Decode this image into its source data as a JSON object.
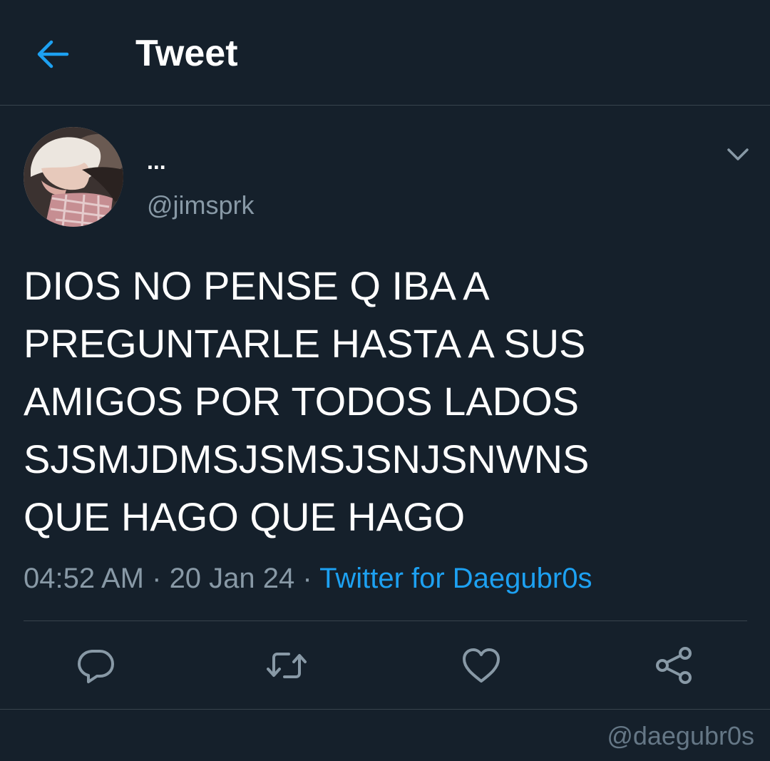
{
  "header": {
    "back_icon": "arrow-left-icon",
    "title": "Tweet"
  },
  "tweet": {
    "display_name": "...",
    "handle": "@jimsprk",
    "text_lines": [
      "DIOS NO PENSE Q IBA A",
      "PREGUNTARLE HASTA A SUS",
      "AMIGOS POR TODOS LADOS",
      "SJSMJDMSJSMSJSNJSNWNS",
      "QUE HAGO QUE HAGO"
    ],
    "time": "04:52 AM",
    "separator": " · ",
    "date": "20 Jan 24",
    "source": "Twitter for Daegubr0s"
  },
  "actions": {
    "reply_icon": "reply-icon",
    "retweet_icon": "retweet-icon",
    "like_icon": "heart-icon",
    "share_icon": "share-icon"
  },
  "watermark": "@daegubr0s",
  "colors": {
    "background": "#15202b",
    "accent": "#1da1f2",
    "muted_text": "#8899a6",
    "divider": "#38444d"
  }
}
